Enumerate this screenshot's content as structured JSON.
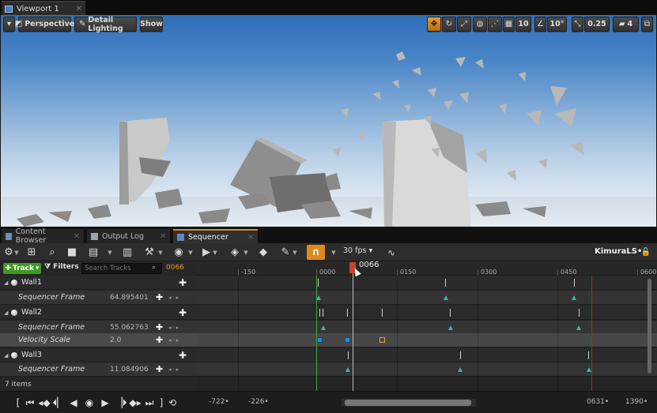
{
  "viewport_tab": {
    "title": "Viewport 1"
  },
  "viewport_toolbar": {
    "perspective": "Perspective",
    "lighting": "Detail Lighting",
    "show": "Show",
    "grid_snap": "10",
    "rotation_snap": "10°",
    "scale_snap": "0.25",
    "camera_speed": "4"
  },
  "panel_tabs": [
    {
      "label": "Content Browser"
    },
    {
      "label": "Output Log"
    },
    {
      "label": "Sequencer"
    }
  ],
  "sequencer_toolbar": {
    "fps": "30 fps",
    "user_label": "KimuraLS•",
    "icons": [
      "settings-icon",
      "camera-add-icon",
      "search-icon",
      "camera-icon",
      "clapper-icon",
      "render-icon",
      "tools-icon",
      "eye-icon",
      "play-icon",
      "key-icon",
      "keyframe-icon",
      "pencil-icon",
      "magnet-icon",
      "curve-editor-icon"
    ]
  },
  "tracks_panel": {
    "add_track": "Track",
    "filters": "Filters",
    "search_placeholder": "Search Tracks",
    "current_frame": "0066",
    "rows": [
      {
        "kind": "object",
        "label": "Wall1"
      },
      {
        "kind": "property",
        "label": "Sequencer Frame",
        "value": "64.895401"
      },
      {
        "kind": "object",
        "label": "Wall2"
      },
      {
        "kind": "property",
        "label": "Sequencer Frame",
        "value": "55.062763"
      },
      {
        "kind": "property",
        "label": "Velocity Scale",
        "value": "2.0"
      },
      {
        "kind": "object",
        "label": "Wall3"
      },
      {
        "kind": "property",
        "label": "Sequencer Frame",
        "value": "11.084906"
      }
    ],
    "items_count": "7 items"
  },
  "timeline": {
    "ruler_labels": [
      "-150",
      "0000",
      "0150",
      "0300",
      "0450",
      "0600"
    ],
    "playhead_frame": "0066"
  },
  "bottom_bar": {
    "view_start": "-722•",
    "working_start": "-226•",
    "working_end": "0631•",
    "view_end": "1390•"
  },
  "colors": {
    "accent_orange": "#e08a1e",
    "track_add_green": "#3f9b1f",
    "key_teal": "#35b7a6",
    "key_blue": "#1f8fd8",
    "start_green": "#3aa83a",
    "end_red": "#b02424",
    "playhead": "#c7442a"
  }
}
